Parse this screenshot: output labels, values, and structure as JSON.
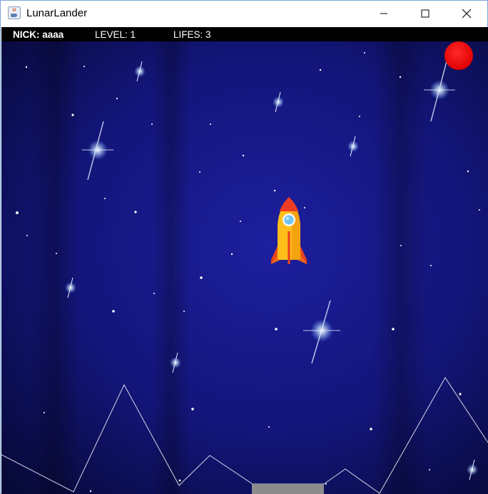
{
  "window": {
    "title": "LunarLander",
    "icon": "java-cup-icon",
    "controls": [
      "minimize-icon",
      "maximize-icon",
      "close-icon"
    ]
  },
  "hud": {
    "nick": "NICK: aaaa",
    "level": "LEVEL: 1",
    "lifes": "LIFES: 3"
  },
  "game": {
    "background": "starfield-night",
    "status_light_color": "#ff0000",
    "ship": "rocket",
    "landing_pad_color": "#8c8c8c",
    "terrain_color": "#d6d6e6"
  },
  "colors": {
    "space_dark": "#07093a",
    "space_mid": "#15168a",
    "hud_bg": "#000000"
  }
}
